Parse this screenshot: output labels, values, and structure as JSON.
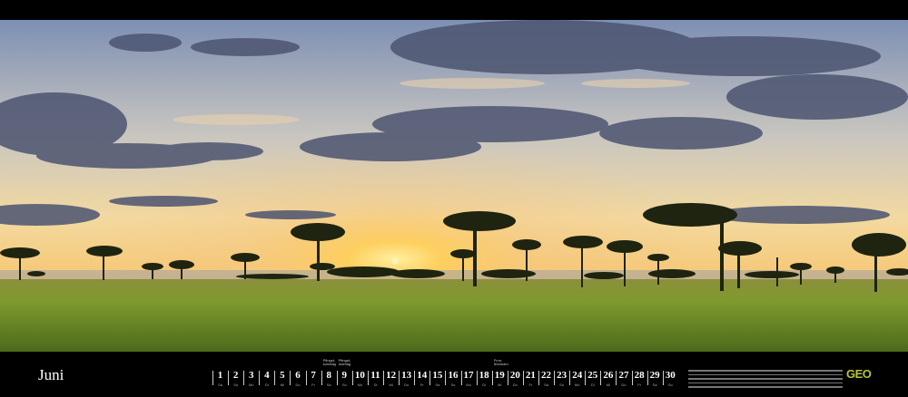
{
  "calendar": {
    "month": "Juni",
    "days": [
      {
        "n": "1",
        "wd": "Sa"
      },
      {
        "n": "2",
        "wd": "So"
      },
      {
        "n": "3",
        "wd": "Mo"
      },
      {
        "n": "4",
        "wd": "Di"
      },
      {
        "n": "5",
        "wd": "Mi"
      },
      {
        "n": "6",
        "wd": "Do"
      },
      {
        "n": "7",
        "wd": "Fr"
      },
      {
        "n": "8",
        "wd": "Sa",
        "note": "Pfingst-\nsonntag"
      },
      {
        "n": "9",
        "wd": "So",
        "note": "Pfingst-\nmontag"
      },
      {
        "n": "10",
        "wd": "Mo"
      },
      {
        "n": "11",
        "wd": "Di"
      },
      {
        "n": "12",
        "wd": "Mi"
      },
      {
        "n": "13",
        "wd": "Do"
      },
      {
        "n": "14",
        "wd": "Fr"
      },
      {
        "n": "15",
        "wd": "Sa"
      },
      {
        "n": "16",
        "wd": "So"
      },
      {
        "n": "17",
        "wd": "Mo"
      },
      {
        "n": "18",
        "wd": "Di"
      },
      {
        "n": "19",
        "wd": "Mi",
        "note": "Fron-\nleichnam"
      },
      {
        "n": "20",
        "wd": "Do"
      },
      {
        "n": "21",
        "wd": "Fr"
      },
      {
        "n": "22",
        "wd": "Sa"
      },
      {
        "n": "23",
        "wd": "So"
      },
      {
        "n": "24",
        "wd": "Mo"
      },
      {
        "n": "25",
        "wd": "Di"
      },
      {
        "n": "26",
        "wd": "Mi"
      },
      {
        "n": "27",
        "wd": "Do"
      },
      {
        "n": "28",
        "wd": "Fr"
      },
      {
        "n": "29",
        "wd": "Sa"
      },
      {
        "n": "30",
        "wd": "So"
      }
    ]
  },
  "brand": {
    "logo": "GEO",
    "logo_color": "#b9c43a"
  },
  "colors": {
    "sky_top": "#7d8fb4",
    "sun": "#ffd23c",
    "grass": "#6f8a2a",
    "border": "#000000"
  }
}
